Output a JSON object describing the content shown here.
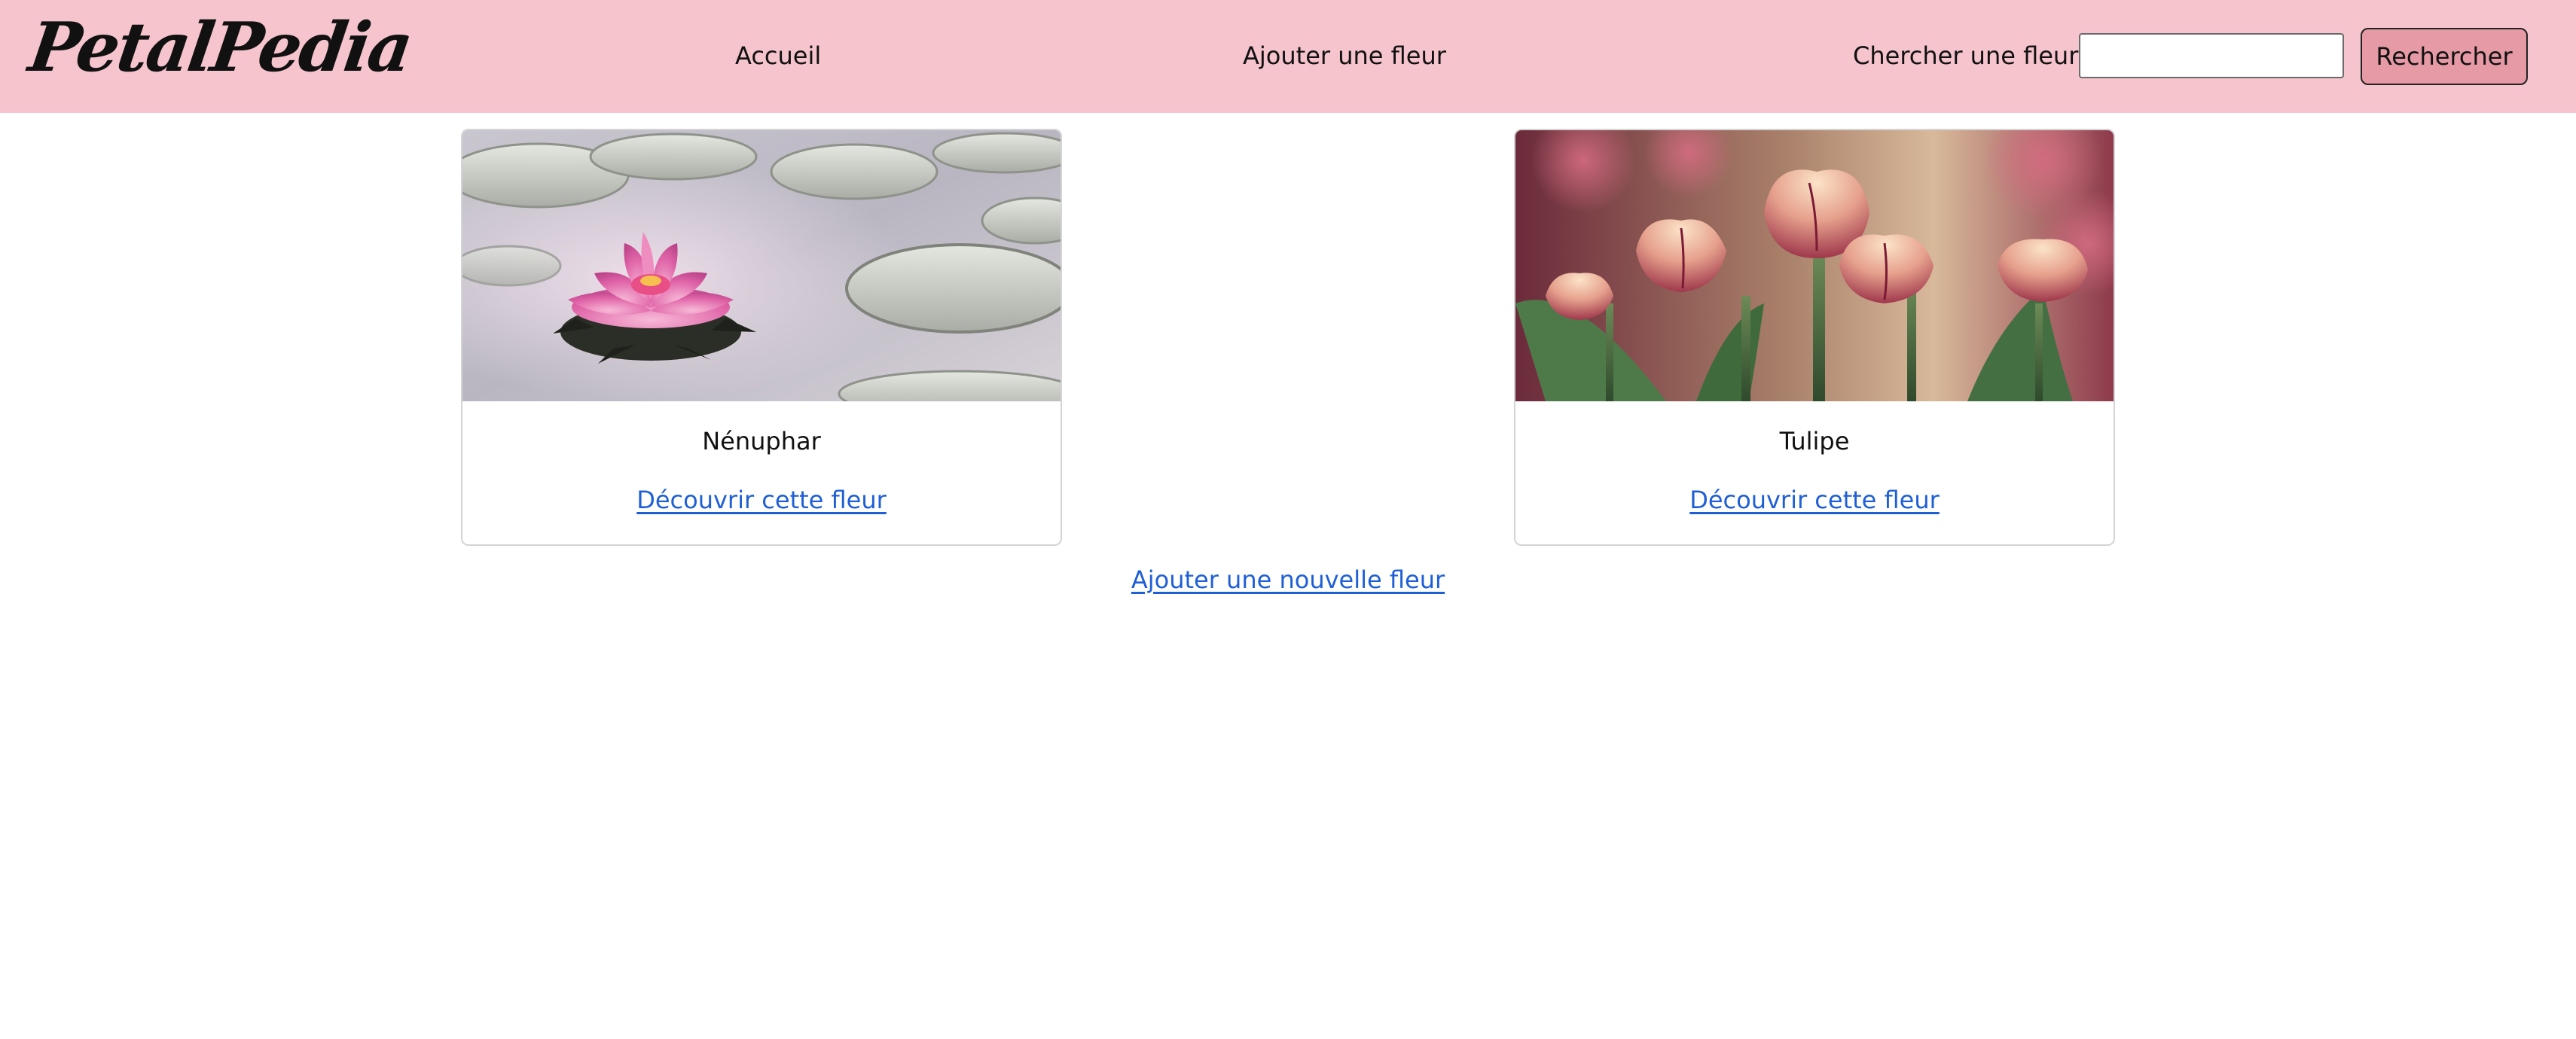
{
  "app": {
    "logo_text": "PetalPedia"
  },
  "nav": {
    "home_label": "Accueil",
    "add_flower_label": "Ajouter une fleur"
  },
  "search": {
    "label": "Chercher une fleur :",
    "value": "",
    "placeholder": "",
    "button_label": "Rechercher"
  },
  "cards": [
    {
      "name": "Nénuphar",
      "link_label": "Découvrir cette fleur",
      "image": "water-lily-photo"
    },
    {
      "name": "Tulipe",
      "link_label": "Découvrir cette fleur",
      "image": "tulips-photo"
    }
  ],
  "footer": {
    "add_new_label": "Ajouter une nouvelle fleur"
  },
  "colors": {
    "header_background": "#f5c4cd",
    "search_button_background": "#e59aa6",
    "link": "#1f5fd6",
    "card_border": "#d4d4d4"
  }
}
